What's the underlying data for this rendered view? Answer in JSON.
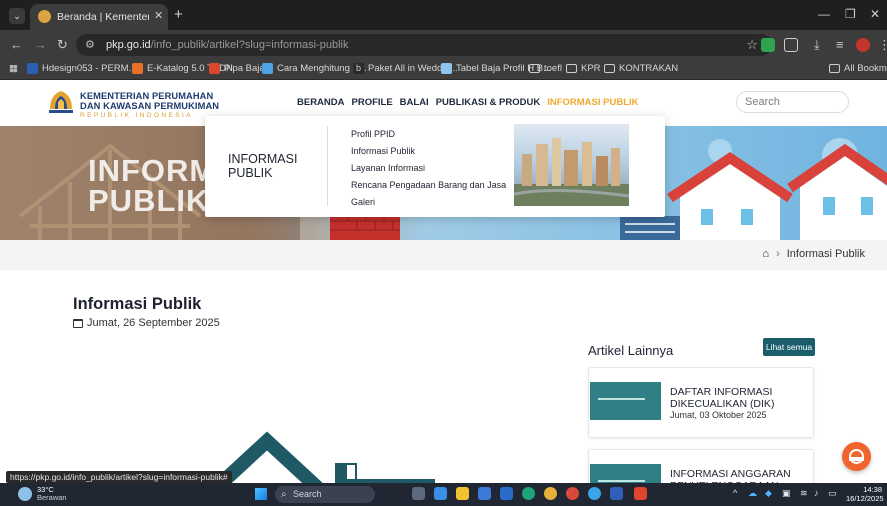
{
  "browser": {
    "tab_title": "Beranda | Kementerian Perumahan",
    "url_host": "pkp.go.id",
    "url_path": "/info_publik/artikel?slug=informasi-publik",
    "bookmarks": [
      "Hdesign053 - PERM...",
      "E-Katalog 5.0 TKDN",
      "Pipa Baja",
      "Cara Menghitung B...",
      "Paket All in Weddin...",
      "Tabel Baja Profil H B...",
      "toefl",
      "KPR",
      "KONTRAKAN"
    ],
    "all_bookmarks": "All Bookmarks",
    "status_url": "https://pkp.go.id/info_publik/artikel?slug=informasi-publik#"
  },
  "site": {
    "logo_line1": "KEMENTERIAN PERUMAHAN",
    "logo_line2": "DAN KAWASAN PERMUKIMAN",
    "logo_line3": "REPUBLIK INDONESIA",
    "nav": [
      "BERANDA",
      "PROFILE",
      "BALAI",
      "PUBLIKASI & PRODUK",
      "INFORMASI PUBLIK"
    ],
    "search_placeholder": "Search",
    "hero_title_line1": "INFORMASI",
    "hero_title_line2": "PUBLIK",
    "dropdown": {
      "heading": "INFORMASI PUBLIK",
      "items": [
        "Profil PPID",
        "Informasi Publik",
        "Layanan Informasi",
        "Rencana Pengadaan Barang dan Jasa",
        "Galeri"
      ]
    },
    "breadcrumb_current": "Informasi Publik",
    "article_title": "Informasi Publik",
    "article_date": "Jumat, 26 September 2025",
    "sidebar": {
      "title": "Artikel Lainnya",
      "see_all": "Lihat semua",
      "cards": [
        {
          "title": "DAFTAR INFORMASI DIKECUALIKAN (DIK)",
          "date": "Jumat, 03 Oktober 2025"
        },
        {
          "title": "INFORMASI ANGGARAN PENYELENGGARAAN PPID",
          "date": ""
        }
      ]
    }
  },
  "taskbar": {
    "temp": "33°C",
    "weather": "Berawan",
    "search": "Search",
    "time": "14:38",
    "date": "16/12/2025"
  },
  "colors": {
    "nav_active": "#f0a92e",
    "see_all_button": "#1b5e6b",
    "help_button": "#f0642e"
  }
}
